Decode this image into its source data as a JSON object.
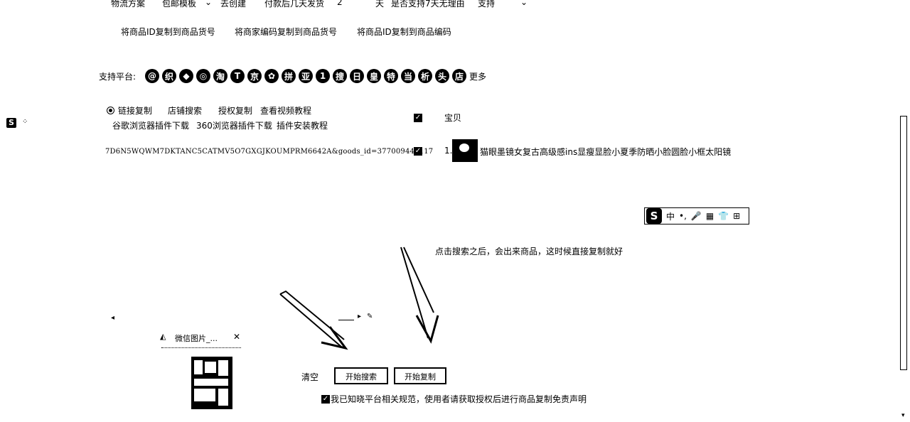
{
  "top_row": {
    "logistics_label": "物流方案",
    "template_value": "包邮模板",
    "create_link": "去创建",
    "ship_after_pay": "付款后几天发货",
    "days_value": "2",
    "days_unit": "天",
    "return_label": "是否支持7天无理由",
    "return_value": "支持"
  },
  "copy_options": [
    "将商品ID复制到商品货号",
    "将商家编码复制到商品货号",
    "将商品ID复制到商品编码"
  ],
  "platforms": {
    "label": "支持平台:",
    "icons": [
      "@",
      "织",
      "◆",
      "◎",
      "淘",
      "T",
      "京",
      "✿",
      "拼",
      "亚",
      "1",
      "搜",
      "日",
      "皇",
      "特",
      "当",
      "析",
      "头",
      "店"
    ],
    "more": "更多"
  },
  "mode_tabs": [
    {
      "label": "链接复制",
      "selected": true
    },
    {
      "label": "店铺搜索"
    },
    {
      "label": "授权复制"
    },
    {
      "label": "查看视频教程"
    }
  ],
  "plugin_links": [
    "谷歌浏览器插件下载",
    "360浏览器插件下载",
    "插件安装教程"
  ],
  "link_input": "7D6N5WQWM7DKTANC5CATMV5O7GXGJKOUMPRM6642A&goods_id=377009448117",
  "results": {
    "header": "宝贝",
    "items": [
      {
        "index": "1.",
        "title": "猫眼墨镜女复古高级感ins显瘦显脸小夏季防晒小脸圆脸小框太阳镜",
        "checked": true
      }
    ]
  },
  "ime": {
    "logo": "S",
    "lang": "中",
    "items": [
      "•,",
      "🎤",
      "▦",
      "👕",
      "⊞"
    ]
  },
  "annotation": "点击搜索之后，会出来商品，这时候直接复制就好",
  "mini_window": {
    "title": "微信图片_...",
    "close": "✕"
  },
  "actions": {
    "clear_label": "清空",
    "search_button": "开始搜索",
    "copy_button": "开始复制"
  },
  "agreement": "我已知晓平台相关规范，使用者请获取授权后进行商品复制免责声明",
  "colors": {
    "ink": "#000000",
    "bg": "#ffffff"
  }
}
